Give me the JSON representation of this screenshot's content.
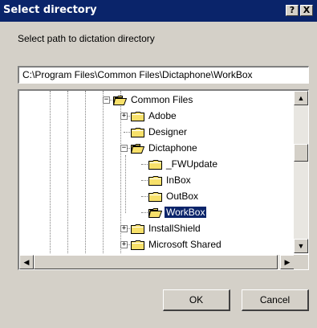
{
  "window": {
    "title": "Select directory",
    "help_label": "?",
    "close_label": "X"
  },
  "dialog": {
    "prompt": "Select path to dictation directory",
    "path_value": "C:\\Program Files\\Common Files\\Dictaphone\\WorkBox"
  },
  "tree": {
    "nodes": [
      {
        "label": "Common Files",
        "expander": "−",
        "state": "open"
      },
      {
        "label": "Adobe",
        "expander": "+",
        "state": "closed"
      },
      {
        "label": "Designer",
        "expander": "",
        "state": "closed"
      },
      {
        "label": "Dictaphone",
        "expander": "−",
        "state": "open"
      },
      {
        "label": "_FWUpdate",
        "expander": "",
        "state": "closed"
      },
      {
        "label": "InBox",
        "expander": "",
        "state": "closed"
      },
      {
        "label": "OutBox",
        "expander": "",
        "state": "closed"
      },
      {
        "label": "WorkBox",
        "expander": "",
        "state": "open",
        "selected": true
      },
      {
        "label": "InstallShield",
        "expander": "+",
        "state": "closed"
      },
      {
        "label": "Microsoft Shared",
        "expander": "+",
        "state": "closed"
      }
    ]
  },
  "buttons": {
    "ok_label": "OK",
    "cancel_label": "Cancel"
  },
  "colors": {
    "titlebar": "#0a246a",
    "dialog_bg": "#d4d0c8",
    "folder_fill": "#f7e06a",
    "selection": "#0a246a"
  },
  "icons": {
    "folder": "folder-icon",
    "folder_open": "folder-open-icon"
  }
}
